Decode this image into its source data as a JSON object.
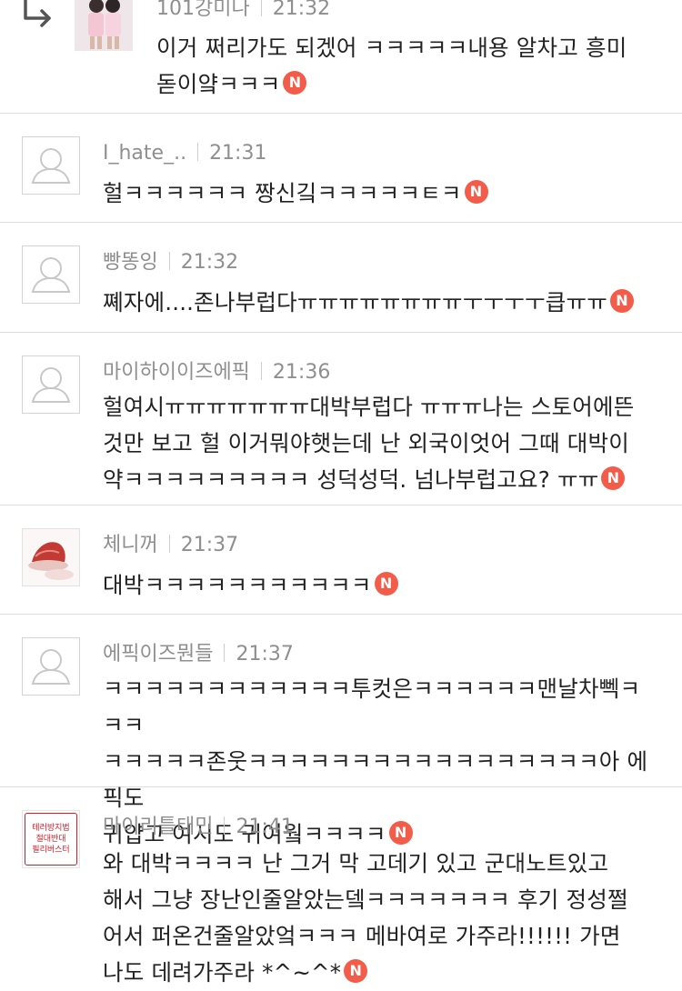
{
  "comments": [
    {
      "author": "101강미나",
      "time": "21:32",
      "lines": [
        "이거 쩌리가도 되겠어 ㅋㅋㅋㅋㅋ내용 알차고 흥미",
        "돋이얔ㅋㅋㅋ"
      ],
      "avatar": "photo-girls",
      "reply": true
    },
    {
      "author": "I_hate_..",
      "time": "21:31",
      "lines": [
        "헐ㅋㅋㅋㅋㅋㅋ 짱신깈ㅋㅋㅋㅋㅋㅌㅋ"
      ],
      "avatar": "default"
    },
    {
      "author": "빵똥잉",
      "time": "21:32",
      "lines": [
        "쪠자에....존나부럽다ㅠㅠㅠㅠㅠㅠㅠㅠㅜㅜㅜㅜ큽ㅠㅠ"
      ],
      "avatar": "default"
    },
    {
      "author": "마이하이이즈에픽",
      "time": "21:36",
      "lines": [
        "헐여시ㅠㅠㅠㅠㅠㅠㅠ대박부럽다 ㅠㅠㅠ나는 스토어에뜬",
        "것만 보고 헐 이거뭐야햇는데 난 외국이엇어 그때 대박이",
        "약ㅋㅋㅋㅋㅋㅋㅋㅋㅋ 성덕성덕. 넘나부럽고요? ㅠㅠ"
      ],
      "avatar": "default"
    },
    {
      "author": "체니꺼",
      "time": "21:37",
      "lines": [
        "대박ㅋㅋㅋㅋㅋㅋㅋㅋㅋㅋㅋ"
      ],
      "avatar": "hat-image"
    },
    {
      "author": "에픽이즈뭔들",
      "time": "21:37",
      "lines": [
        "ㅋㅋㅋㅋㅋㅋㅋㅋㅋㅋㅋㅋ투컷은ㅋㅋㅋㅋㅋㅋ맨날차뻭ㅋㅋㅋ",
        "ㅋㅋㅋㅋㅋ존웃ㅋㅋㅋㅋㅋㅋㅋㅋㅋㅋㅋㅋㅋㅋㅋㅋㅋ아 에픽도",
        "귀얍고 여시도 귀여웤ㅋㅋㅋㅋ"
      ],
      "avatar": "default"
    },
    {
      "author": "마이리틀태민",
      "time": "21:41",
      "lines": [
        "와 대박ㅋㅋㅋㅋ 난 그거 막 고데기 있고 군대노트있고",
        "해서 그냥 장난인줄알았는뎈ㅋㅋㅋㅋㅋㅋㅋ 후기 정성쩔",
        "어서 퍼온건줄알았엌ㅋㅋㅋ 메바여로 가주라!!!!!! 가면",
        "나도 데려가주라 *^~^*"
      ],
      "avatar": "stamp"
    }
  ],
  "stamp_text": [
    "테러방지법",
    "절대반대",
    "필리버스터"
  ],
  "badge_label": "N",
  "colors": {
    "badge": "#f25c49",
    "meta": "#8f8f8f",
    "text": "#222222",
    "divider": "#dcdcdc",
    "stamp": "#d0202a"
  }
}
